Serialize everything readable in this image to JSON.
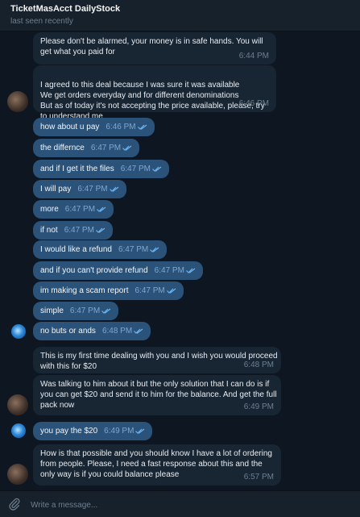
{
  "header": {
    "title": "TicketMasAcct DailyStock",
    "status": "last seen recently"
  },
  "messages": [
    {
      "dir": "in",
      "text": "Please don't be alarmed, your money is in safe hands. You will get what you paid for",
      "time": "6:44 PM"
    },
    {
      "dir": "in",
      "text": "I agreed to this deal because I was sure it was available\nWe get orders everyday and for different denominations\nBut as of today it's not accepting the price available, please, try to understand me",
      "time": "6:46 PM"
    },
    {
      "dir": "out",
      "text": "how about u pay",
      "time": "6:46 PM"
    },
    {
      "dir": "out",
      "text": "the differnce",
      "time": "6:47 PM"
    },
    {
      "dir": "out",
      "text": "and if I get it the files",
      "time": "6:47 PM"
    },
    {
      "dir": "out",
      "text": "I will pay",
      "time": "6:47 PM"
    },
    {
      "dir": "out",
      "text": "more",
      "time": "6:47 PM"
    },
    {
      "dir": "out",
      "text": "if not",
      "time": "6:47 PM"
    },
    {
      "dir": "out",
      "text": "I would like a refund",
      "time": "6:47 PM"
    },
    {
      "dir": "out",
      "text": "and if you can't provide refund",
      "time": "6:47 PM"
    },
    {
      "dir": "out",
      "text": "im making a scam report",
      "time": "6:47 PM"
    },
    {
      "dir": "out",
      "text": "simple",
      "time": "6:47 PM"
    },
    {
      "dir": "out",
      "text": "no buts or ands",
      "time": "6:48 PM"
    },
    {
      "dir": "in",
      "text": "This is my first time dealing with you and I wish you would proceed with this for $20",
      "time": "6:48 PM"
    },
    {
      "dir": "in",
      "text": "Was talking to him about it but the only solution that I can do is if you can get $20 and send it to him for the balance. And get the full pack now",
      "time": "6:49 PM"
    },
    {
      "dir": "out",
      "text": "you pay the $20",
      "time": "6:49 PM"
    },
    {
      "dir": "in",
      "text": "How is that possible and you should know I have a lot of ordering from people. Please, I need a fast response about this and the only way is if you could balance please",
      "time": "6:57 PM"
    }
  ],
  "composer": {
    "placeholder": "Write a message..."
  },
  "icons": {
    "attach": "paperclip-icon",
    "read": "double-check-icon"
  },
  "colors": {
    "background": "#0e1621",
    "incoming": "#182533",
    "outgoing": "#2b5278",
    "header": "#17212b",
    "tick": "#6ab3f3"
  }
}
